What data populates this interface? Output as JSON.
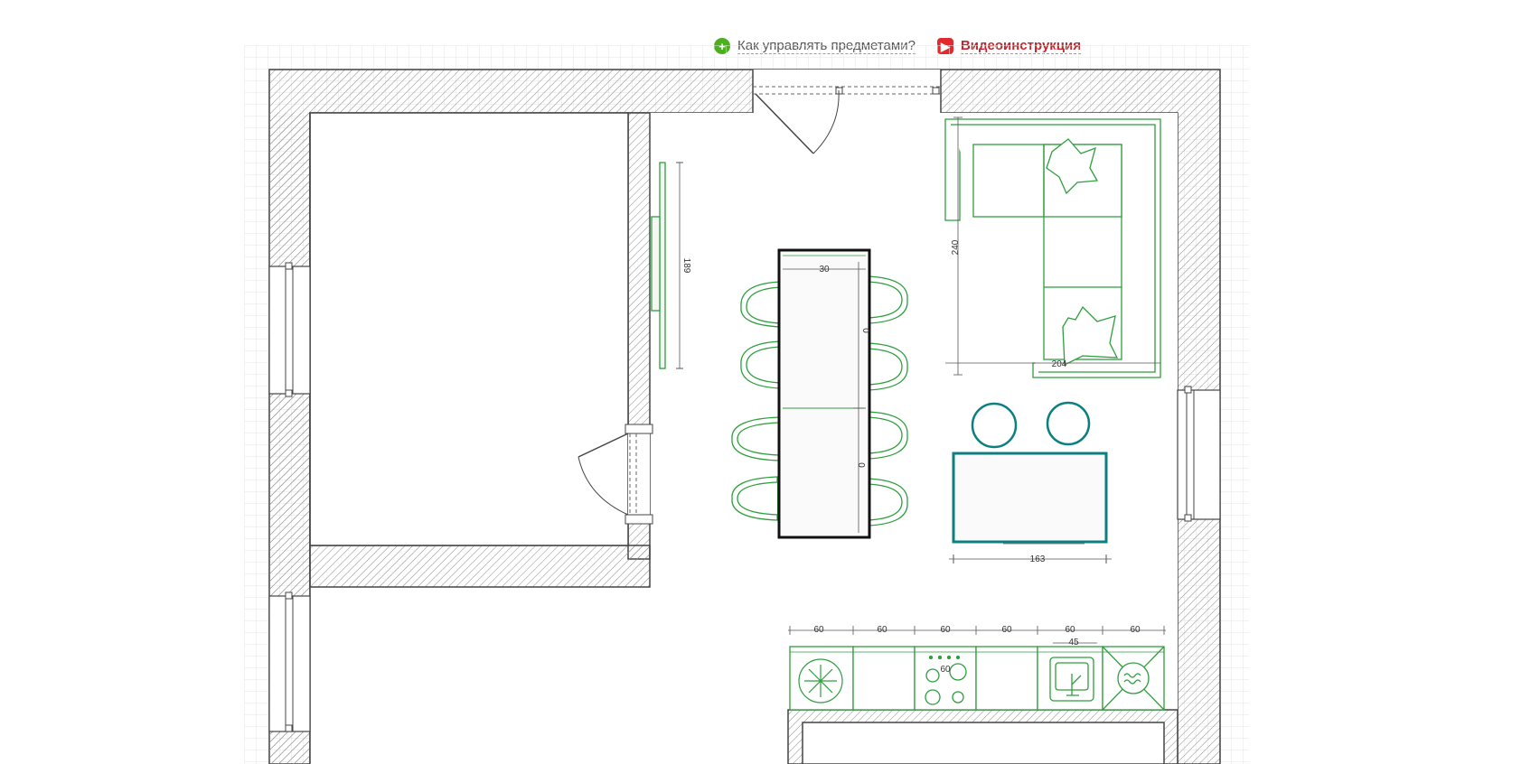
{
  "help": {
    "manage_label": "Как управлять предметами?",
    "video_label": "Видеоинструкция",
    "manage_icon": "plus-circle-icon",
    "video_icon": "play-icon",
    "manage_color": "#4caf1f",
    "video_color": "#e02a2e"
  },
  "dimensions": {
    "wardrobe_width": "189",
    "sofa_depth": "240",
    "sofa_width": "204",
    "table_width": "30",
    "table_seg_1": "0",
    "table_seg_2": "0",
    "desk_width": "163",
    "cab_1": "60",
    "cab_2": "60",
    "cab_3": "60",
    "cab_4": "60",
    "cab_5": "60",
    "cab_6": "60",
    "sink_width": "45",
    "hob_width": "60"
  },
  "colors": {
    "wall": "#444444",
    "furniture": "#2e9e3e",
    "teal": "#0c7f80",
    "table": "#111111",
    "grid": "#e6e6e6"
  }
}
